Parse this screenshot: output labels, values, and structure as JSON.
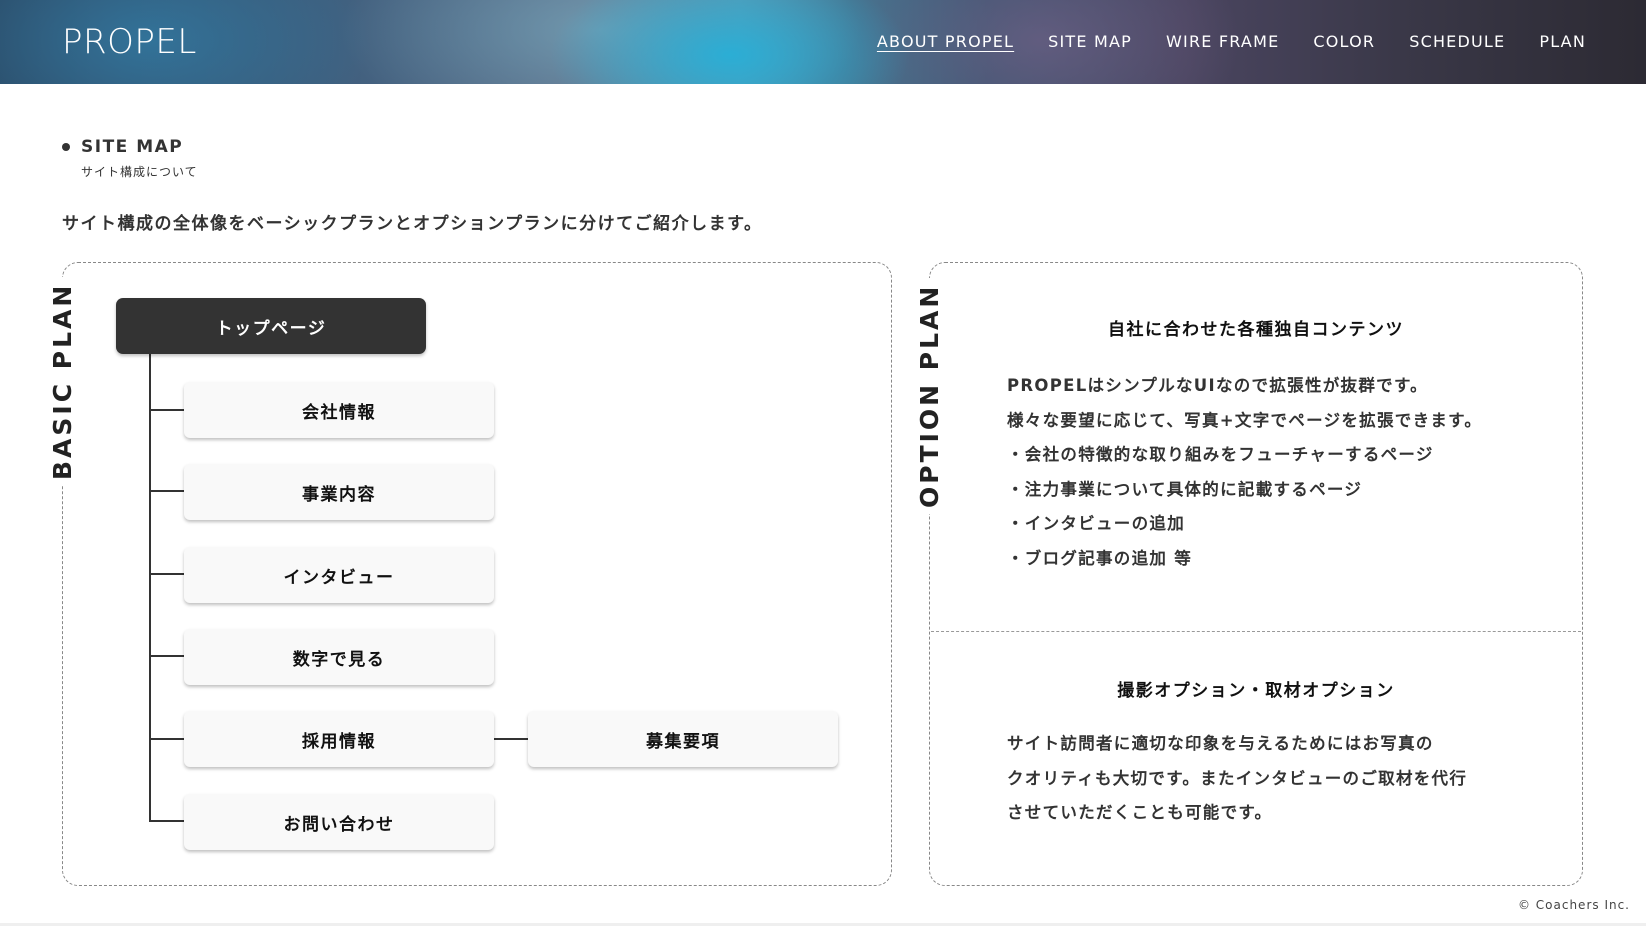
{
  "header": {
    "logo": "PROPEL",
    "nav": [
      {
        "label": "ABOUT PROPEL",
        "active": true
      },
      {
        "label": "SITE MAP",
        "active": false
      },
      {
        "label": "WIRE FRAME",
        "active": false
      },
      {
        "label": "COLOR",
        "active": false
      },
      {
        "label": "SCHEDULE",
        "active": false
      },
      {
        "label": "PLAN",
        "active": false
      }
    ]
  },
  "section": {
    "title": "SITE MAP",
    "subtitle": "サイト構成について",
    "lead": "サイト構成の全体像をベーシックプランとオプションプランに分けてご紹介します。"
  },
  "basic_plan": {
    "label": "BASIC PLAN",
    "top_node": "トップページ",
    "children": [
      "会社情報",
      "事業内容",
      "インタビュー",
      "数字で見る",
      "採用情報",
      "お問い合わせ"
    ],
    "sub_node": "募集要項"
  },
  "option_plan": {
    "label": "OPTION PLAN",
    "block1": {
      "title": "自社に合わせた各種独自コンテンツ",
      "lines": [
        "PROPELはシンプルなUIなので拡張性が抜群です。",
        "様々な要望に応じて、写真+文字でページを拡張できます。",
        "・会社の特徴的な取り組みをフューチャーするページ",
        "・注力事業について具体的に記載するページ",
        "・インタビューの追加",
        "・ブログ記事の追加 等"
      ]
    },
    "block2": {
      "title": "撮影オプション・取材オプション",
      "lines": [
        "サイト訪問者に適切な印象を与えるためにはお写真の",
        "クオリティも大切です。またインタビューのご取材を代行",
        "させていただくことも可能です。"
      ]
    }
  },
  "footer": {
    "copyright": "© Coachers Inc."
  }
}
